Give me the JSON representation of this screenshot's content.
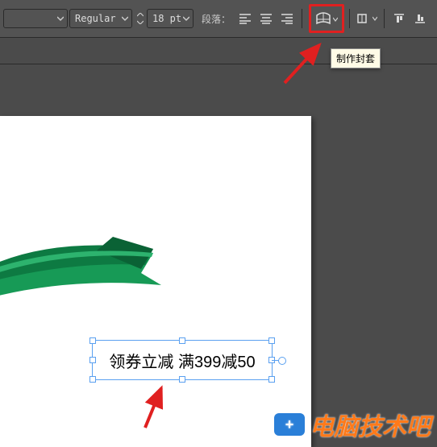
{
  "toolbar": {
    "font_style": "Regular",
    "font_size": "18 pt",
    "paragraph_label": "段落：",
    "warp_tooltip": "制作封套"
  },
  "canvas": {
    "text_content": "领券立减  满399减50"
  },
  "watermark": {
    "text": "电脑技术吧"
  }
}
